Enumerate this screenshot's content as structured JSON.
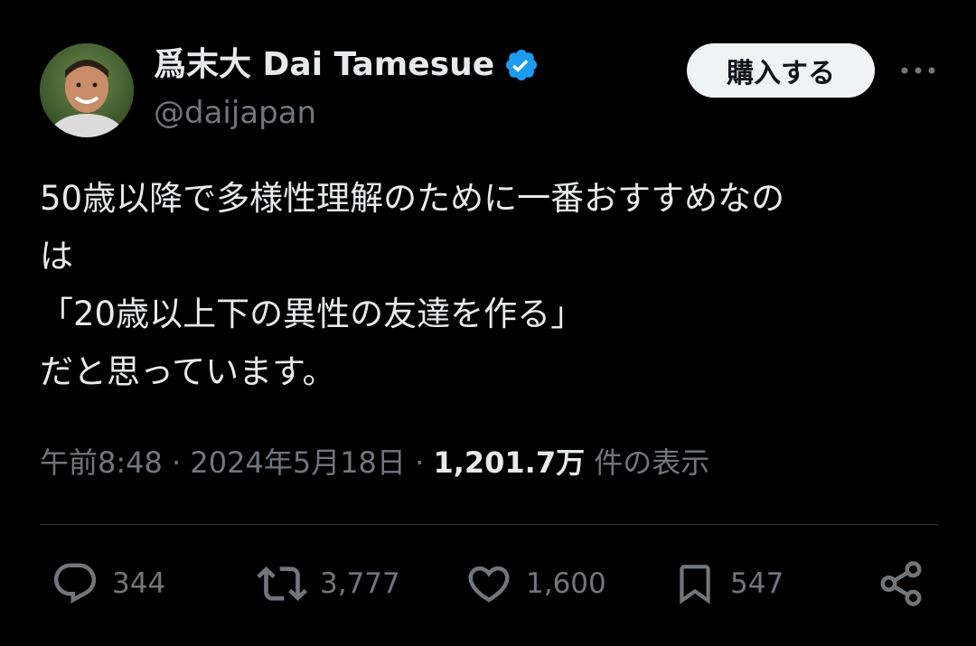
{
  "author": {
    "display_name": "爲末大 Dai Tamesue",
    "handle": "@daijapan",
    "verified_icon": "verified-badge-icon",
    "verified_color": "#1d9bf0"
  },
  "header": {
    "subscribe_label": "購入する",
    "more_icon": "more-horizontal-icon"
  },
  "tweet": {
    "lines": [
      "50歳以降で多様性理解のために一番おすすめなの",
      "は",
      "「20歳以上下の異性の友達を作る」",
      "だと思っています。"
    ]
  },
  "meta": {
    "time": "午前8:48",
    "separator": "·",
    "date": "2024年5月18日",
    "views_count": "1,201.7万",
    "views_label": "件の表示"
  },
  "actions": {
    "replies": "344",
    "retweets": "3,777",
    "likes": "1,600",
    "bookmarks": "547"
  },
  "colors": {
    "background": "#000000",
    "text_primary": "#e7e9ea",
    "text_secondary": "#71767b",
    "divider": "#2f3336",
    "button_bg": "#eff3f4"
  }
}
